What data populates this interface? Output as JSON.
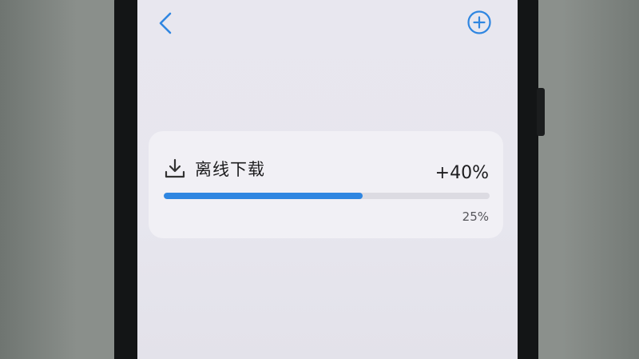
{
  "header": {
    "back_icon": "chevron-left-icon",
    "add_icon": "plus-circle-icon"
  },
  "download_card": {
    "icon": "download-icon",
    "title": "离线下载",
    "change_label": "+40%",
    "progress_label": "25%",
    "progress_fraction": 0.61,
    "accent_color": "#2f86e1"
  }
}
